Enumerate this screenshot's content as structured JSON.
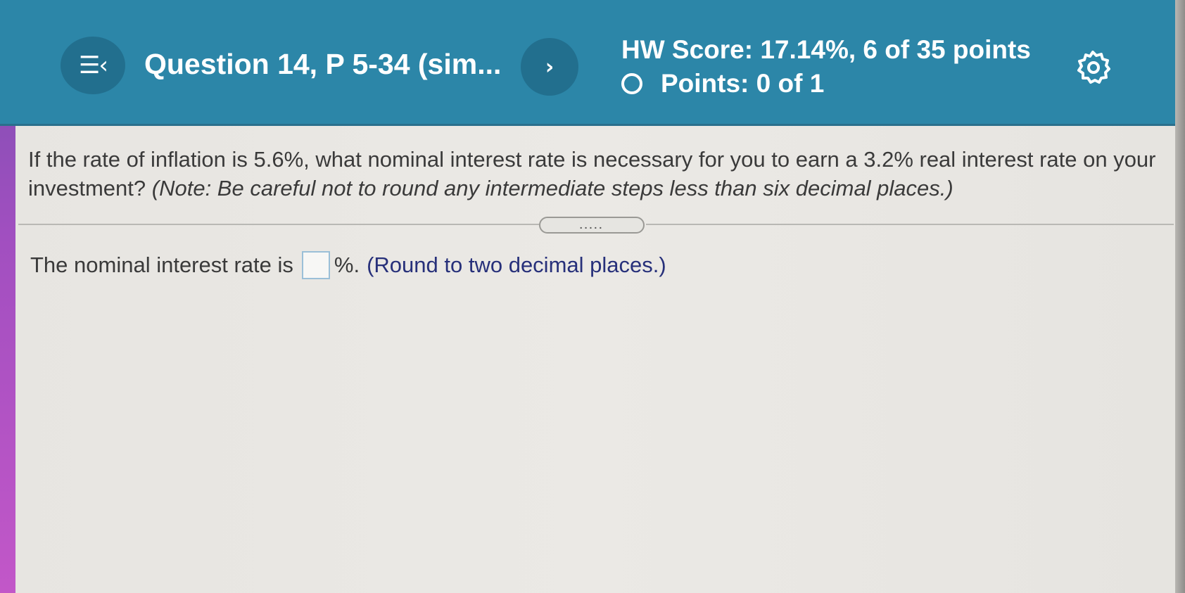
{
  "header": {
    "menu_icon": "menu-list-back-icon",
    "menu_glyph": "☰‹",
    "question_title": "Question 14, P 5-34 (sim...",
    "next_glyph": "›",
    "hw_score": "HW Score: 17.14%, 6 of 35 points",
    "points": "Points: 0 of 1",
    "status_icon": "empty-circle-icon",
    "settings_icon": "gear-icon",
    "background_color": "#2c86a8"
  },
  "question": {
    "text": "If the rate of inflation is 5.6%, what nominal interest rate is necessary for you to earn a 3.2% real interest rate on your investment? ",
    "note": "(Note: Be careful not to round any intermediate steps less than six decimal places.)"
  },
  "expander": {
    "label": "....."
  },
  "answer": {
    "prefix": "The nominal interest rate is",
    "input_value": "",
    "suffix": "%.",
    "instruction": "(Round to two decimal places.)",
    "instruction_color": "#27307a"
  }
}
